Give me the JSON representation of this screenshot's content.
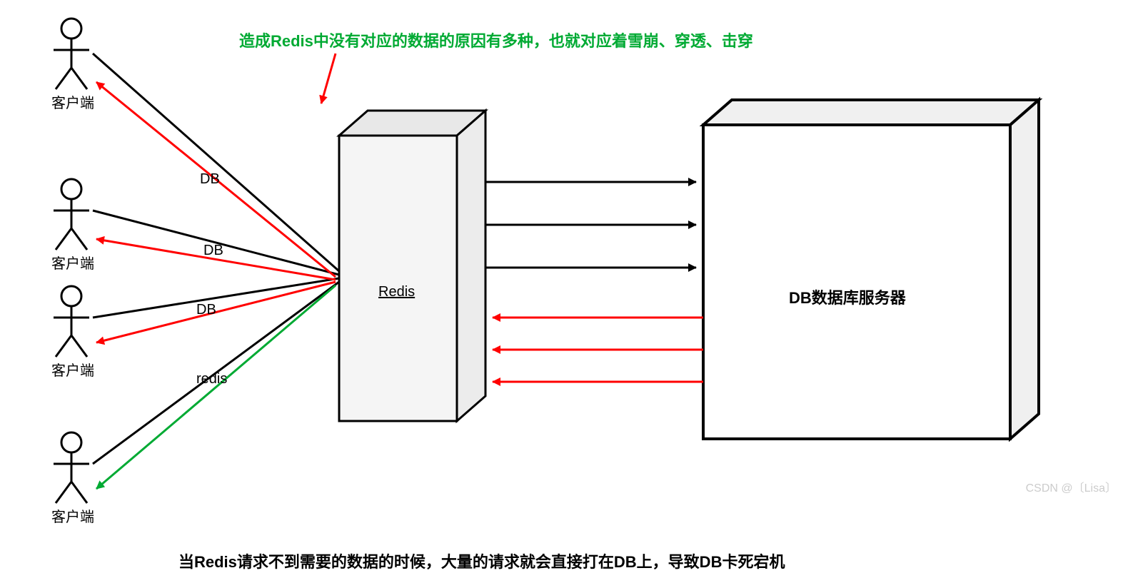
{
  "top_note": "造成Redis中没有对应的数据的原因有多种，也就对应着雪崩、穿透、击穿",
  "bottom_note": "当Redis请求不到需要的数据的时候，大量的请求就会直接打在DB上，导致DB卡死宕机",
  "clients": {
    "c1": "客户端",
    "c2": "客户端",
    "c3": "客户端",
    "c4": "客户端"
  },
  "edge_labels": {
    "e1": "DB",
    "e2": "DB",
    "e3": "DB",
    "e4": "redis"
  },
  "redis_label": "Redis",
  "db_label": "DB数据库服务器",
  "watermark": "CSDN @〔Lisa〕",
  "colors": {
    "green": "#00aa33",
    "red": "#ff0000",
    "black": "#000000",
    "box_fill": "#f0f0f0"
  }
}
